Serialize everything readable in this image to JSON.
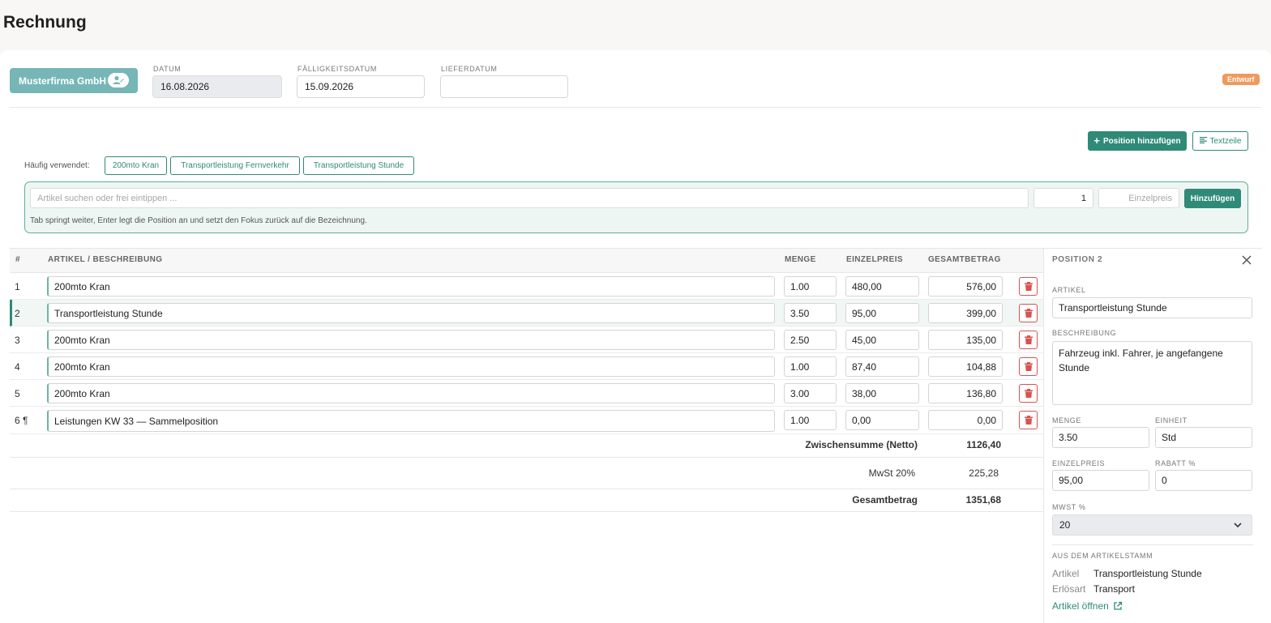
{
  "page_title": "Rechnung",
  "header": {
    "customer": "Musterfirma GmbH",
    "date_label": "DATUM",
    "date_value": "16.08.2026",
    "due_label": "FÄLLIGKEITSDATUM",
    "due_value": "15.09.2026",
    "delivery_label": "LIEFERDATUM",
    "delivery_value": "",
    "status": "Entwurf",
    "status_color": "#ef9a5d"
  },
  "toolbar": {
    "add_position": "Position hinzufügen",
    "text_line": "Textzeile"
  },
  "quick": {
    "label": "Häufig verwendet:",
    "chips": [
      "200mto Kran",
      "Transportleistung Fernverkehr",
      "Transportleistung Stunde"
    ]
  },
  "entry": {
    "search_placeholder": "Artikel suchen oder frei eintippen ...",
    "qty": "1",
    "price_placeholder": "Einzelpreis",
    "add_button": "Hinzufügen",
    "hint": "Tab springt weiter, Enter legt die Position an und setzt den Fokus zurück auf die Bezeichnung."
  },
  "table": {
    "headers": {
      "num": "#",
      "article": "ARTIKEL / BESCHREIBUNG",
      "qty": "MENGE",
      "price": "EINZELPREIS",
      "total": "GESAMTBETRAG"
    },
    "rows": [
      {
        "num": "1",
        "article": "200mto Kran",
        "qty": "1.00",
        "price": "480,00",
        "total": "576,00"
      },
      {
        "num": "2",
        "article": "Transportleistung Stunde",
        "qty": "3.50",
        "price": "95,00",
        "total": "399,00"
      },
      {
        "num": "3",
        "article": "200mto Kran",
        "qty": "2.50",
        "price": "45,00",
        "total": "135,00"
      },
      {
        "num": "4",
        "article": "200mto Kran",
        "qty": "1.00",
        "price": "87,40",
        "total": "104,88"
      },
      {
        "num": "5",
        "article": "200mto Kran",
        "qty": "3.00",
        "price": "38,00",
        "total": "136,80"
      },
      {
        "num": "6 ¶",
        "article": "Leistungen KW 33 — Sammelposition",
        "qty": "1.00",
        "price": "0,00",
        "total": "0,00"
      }
    ],
    "subtotal_label": "Zwischensumme (Netto)",
    "subtotal_value": "1126,40",
    "vat_label": "MwSt 20%",
    "vat_value": "225,28",
    "grand_label": "Gesamtbetrag",
    "grand_value": "1351,68"
  },
  "side": {
    "title": "POSITION 2",
    "article_label": "ARTIKEL",
    "article_value": "Transportleistung Stunde",
    "desc_label": "BESCHREIBUNG",
    "desc_value": "Fahrzeug inkl. Fahrer, je angefangene Stunde",
    "qty_label": "MENGE",
    "qty_value": "3.50",
    "unit_label": "EINHEIT",
    "unit_value": "Std",
    "price_label": "EINZELPREIS",
    "price_value": "95,00",
    "discount_label": "RABATT %",
    "discount_value": "0",
    "vat_label": "MWST %",
    "vat_value": "20",
    "master_label": "AUS DEM ARTIKELSTAMM",
    "master_article_key": "Artikel",
    "master_article_val": "Transportleistung Stunde",
    "master_revenue_key": "Erlösart",
    "master_revenue_val": "Transport",
    "open_link": "Artikel öffnen"
  },
  "colors": {
    "accent": "#2f8a78",
    "danger": "#d9534f"
  }
}
